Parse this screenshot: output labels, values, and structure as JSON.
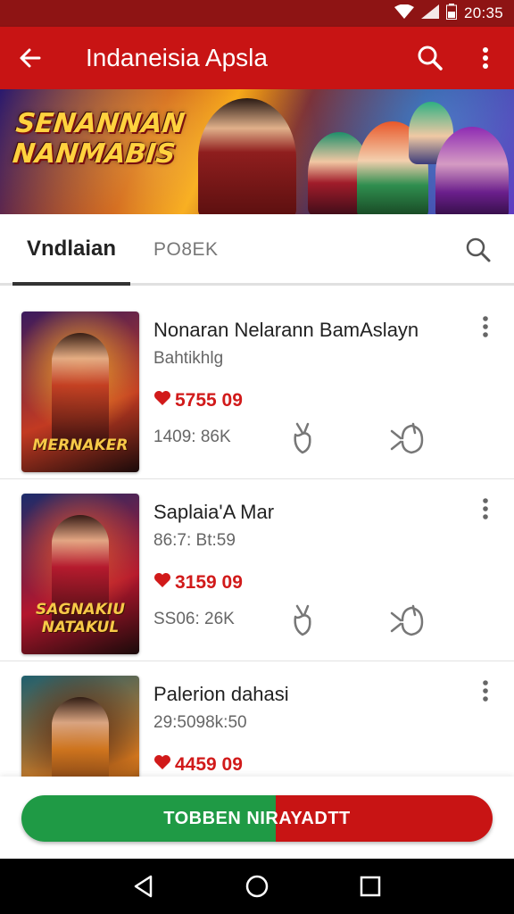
{
  "status_bar": {
    "time": "20:35"
  },
  "app_bar": {
    "title": "Indaneisia Apsla"
  },
  "banner": {
    "logo_text": "SENANNAN NANMABIS"
  },
  "tabs": {
    "active": "Vndlaian",
    "second": "PO8EK"
  },
  "items": [
    {
      "title": "Nonaran Nelarann BamAslayn",
      "subtitle": "Bahtikhlg",
      "price": "5755 09",
      "stat": "1409: 86K",
      "thumb_caption": "MERNAKER",
      "thumb_colors": [
        "#3a1a5e",
        "#c23a22",
        "#f0a52a"
      ]
    },
    {
      "title": "Saplaia'A Mar",
      "subtitle": "86:7: Bt:59",
      "price": "3159 09",
      "stat": "SS06: 26K",
      "thumb_caption": "SAGNAKIU NATAKUL",
      "thumb_colors": [
        "#1b2c6b",
        "#b3162d",
        "#e4572e"
      ]
    },
    {
      "title": "Palerion dahasi",
      "subtitle": "29:5098k:50",
      "price": "4459 09",
      "stat": "",
      "thumb_caption": "",
      "thumb_colors": [
        "#1f5f6e",
        "#d87a1e",
        "#5b2a12"
      ]
    }
  ],
  "cta": {
    "label": "TOBBEN NIRAYADTT"
  },
  "colors": {
    "primary": "#c81414",
    "status": "#8e1414",
    "cta_green": "#1f9a45",
    "price": "#d11a1a"
  },
  "icons": [
    "back-arrow-icon",
    "search-icon",
    "more-vert-icon",
    "heart-icon",
    "hand-icon",
    "nav-back-icon",
    "nav-home-icon",
    "nav-recents-icon"
  ]
}
